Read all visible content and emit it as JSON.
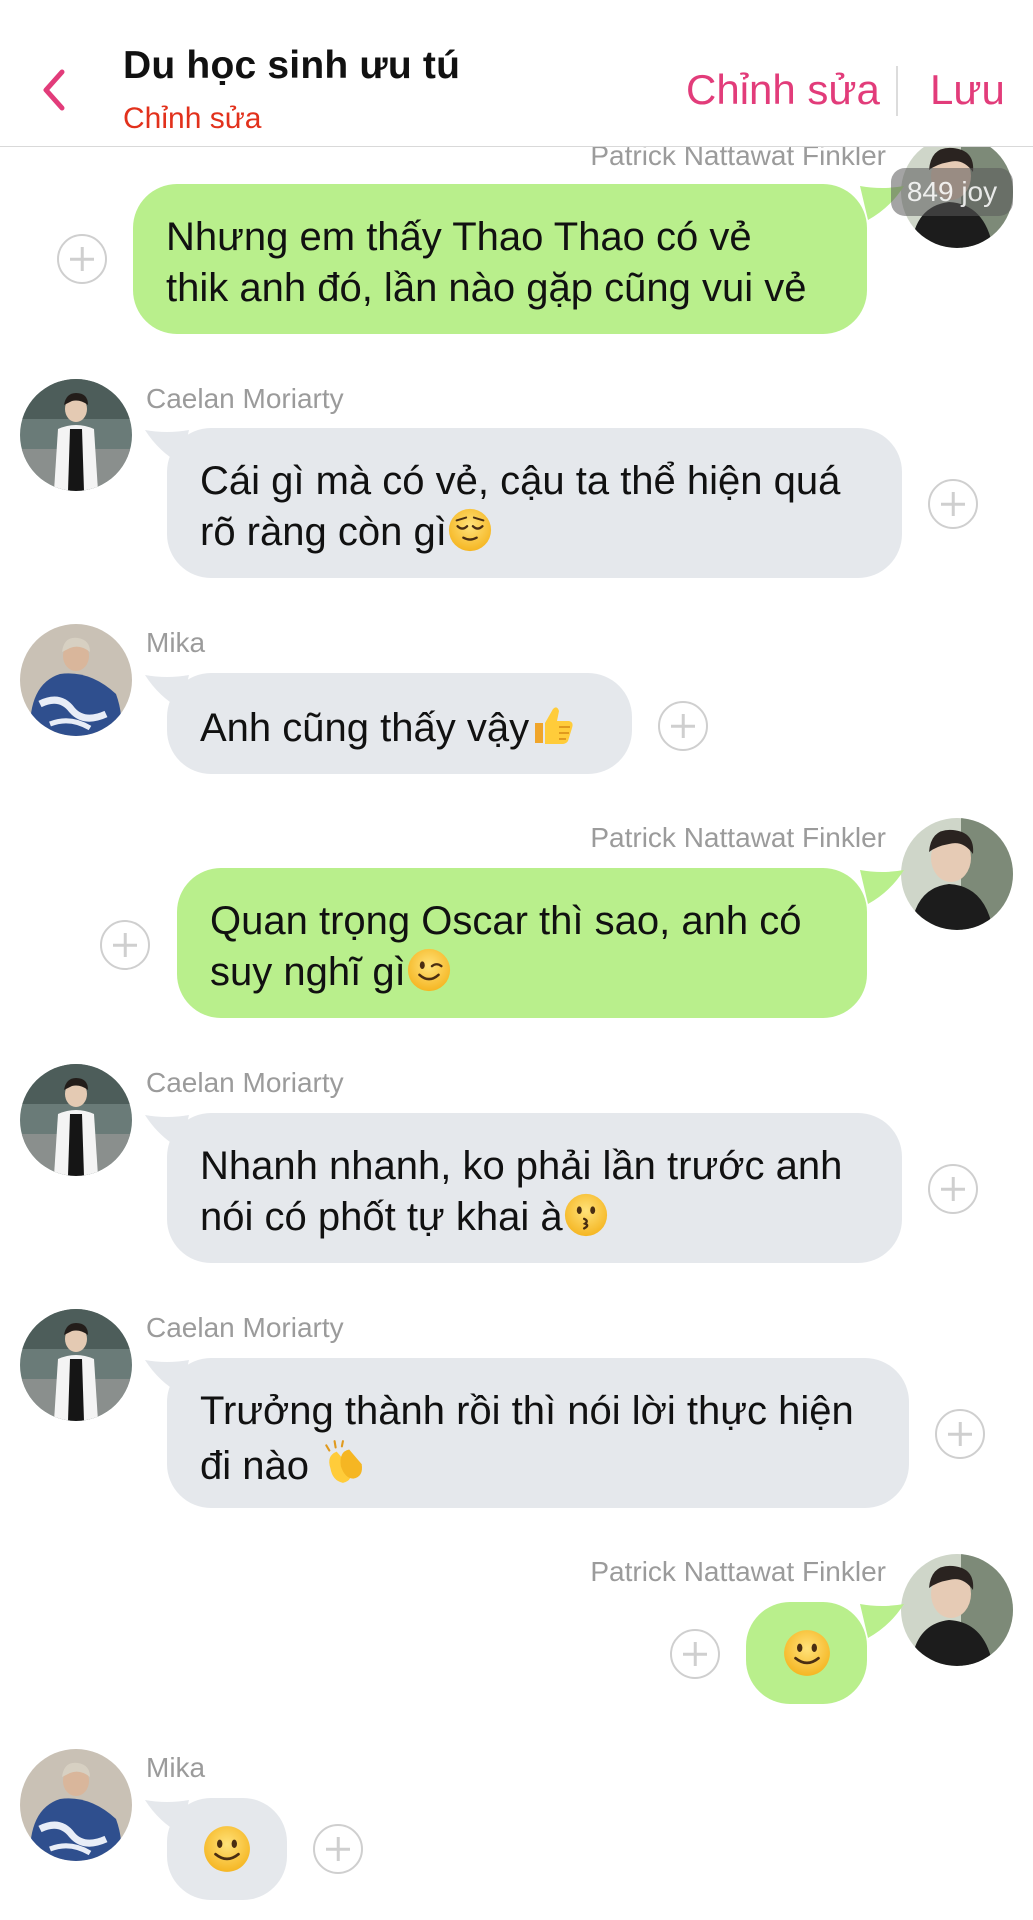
{
  "header": {
    "title": "Du học sinh ưu tú",
    "subtitle": "Chỉnh sửa",
    "edit_label": "Chỉnh sửa",
    "save_label": "Lưu"
  },
  "watermark": "849 joy",
  "messages": [
    {
      "sender": "Patrick Nattawat Finkler",
      "side": "right",
      "text_lines": [
        "Nhưng em thấy Thao Thao có vẻ",
        "thik anh đó, lần nào gặp cũng vui vẻ"
      ]
    },
    {
      "sender": "Caelan Moriarty",
      "side": "left",
      "text_lines": [
        "Cái gì mà có vẻ, cậu ta thể hiện quá",
        "rõ ràng còn gì"
      ],
      "emoji": "relieved-face"
    },
    {
      "sender": "Mika",
      "side": "left",
      "text_lines": [
        "Anh cũng thấy vậy"
      ],
      "emoji": "thumbs-up"
    },
    {
      "sender": "Patrick Nattawat Finkler",
      "side": "right",
      "text_lines": [
        "Quan trọng Oscar thì sao, anh có",
        "suy nghĩ gì"
      ],
      "emoji": "winking-face"
    },
    {
      "sender": "Caelan Moriarty",
      "side": "left",
      "text_lines": [
        "Nhanh nhanh, ko phải lần trước anh",
        "nói có phốt tự khai à"
      ],
      "emoji": "kissing-face"
    },
    {
      "sender": "Caelan Moriarty",
      "side": "left",
      "text_lines": [
        "Trưởng thành rồi thì nói lời thực hiện",
        "đi nào "
      ],
      "emoji": "clapping-hands"
    },
    {
      "sender": "Patrick Nattawat Finkler",
      "side": "right",
      "text_lines": [],
      "emoji": "slightly-smiling-face"
    },
    {
      "sender": "Mika",
      "side": "left",
      "text_lines": [],
      "emoji": "slightly-smiling-face"
    }
  ]
}
